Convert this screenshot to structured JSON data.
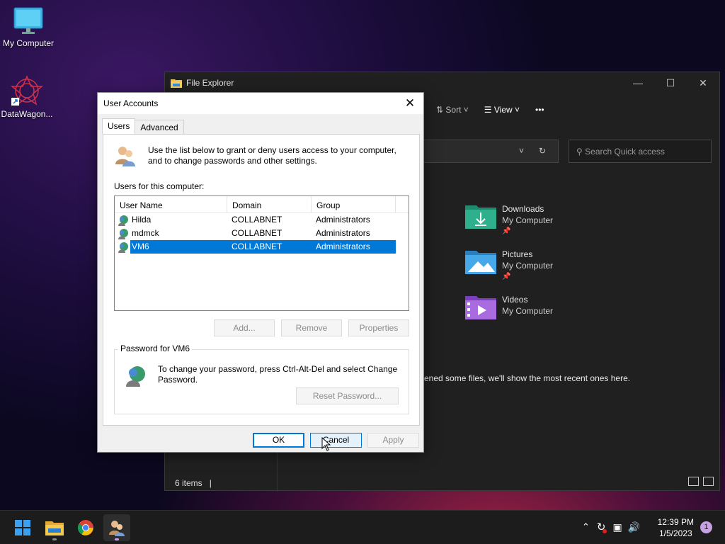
{
  "desktop": {
    "icons": [
      {
        "label": "My Computer"
      },
      {
        "label": "DataWagon..."
      }
    ]
  },
  "explorer": {
    "title": "File Explorer",
    "toolbar": {
      "sort": "Sort",
      "view": "View",
      "more": "•••"
    },
    "search_placeholder": "Search Quick access",
    "quick_access": [
      {
        "name": "Downloads",
        "location": "My Computer",
        "color": "#2e9b7d"
      },
      {
        "name": "Pictures",
        "location": "My Computer",
        "color": "#3a9bd9"
      },
      {
        "name": "Videos",
        "location": "My Computer",
        "color": "#9b59d9"
      }
    ],
    "recent_message": "ened some files, we'll show the most recent ones here.",
    "status": "6 items"
  },
  "dialog": {
    "title": "User Accounts",
    "tabs": [
      "Users",
      "Advanced"
    ],
    "intro": "Use the list below to grant or deny users access to your computer, and to change passwords and other settings.",
    "users_label": "Users for this computer:",
    "columns": [
      "User Name",
      "Domain",
      "Group"
    ],
    "rows": [
      {
        "name": "Hilda",
        "domain": "COLLABNET",
        "group": "Administrators"
      },
      {
        "name": "mdmck",
        "domain": "COLLABNET",
        "group": "Administrators"
      },
      {
        "name": "VM6",
        "domain": "COLLABNET",
        "group": "Administrators"
      }
    ],
    "buttons": {
      "add": "Add...",
      "remove": "Remove",
      "properties": "Properties"
    },
    "password_group": "Password for VM6",
    "password_text": "To change your password, press Ctrl-Alt-Del and select Change Password.",
    "reset_password": "Reset Password...",
    "ok": "OK",
    "cancel": "Cancel",
    "apply": "Apply"
  },
  "taskbar": {
    "time": "12:39 PM",
    "date": "1/5/2023",
    "notifications": "1"
  },
  "colors": {
    "selection": "#0078d7",
    "accent_pink": "#c7a2e0"
  }
}
